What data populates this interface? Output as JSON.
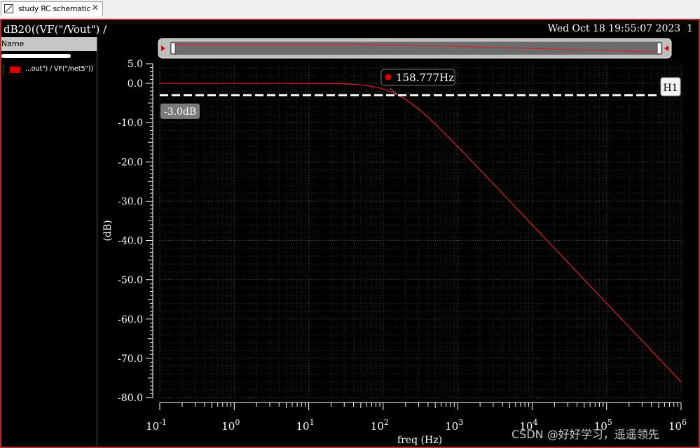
{
  "window": {
    "tab_label": "study RC schematic",
    "tab_close": "✕",
    "tab_icon": "schematic-icon"
  },
  "header": {
    "expression": "dB20((VF(\"/Vout\") /",
    "timestamp": "Wed Oct 18 19:55:07 2023",
    "subwindow_number": "1"
  },
  "sidebar": {
    "column_header": "Name",
    "traces": [
      {
        "label": "...out\") / VF(\"/net5\"))",
        "color": "#e00000"
      }
    ]
  },
  "chart_data": {
    "type": "line",
    "xscale": "log",
    "xlabel": "freq (Hz)",
    "ylabel": "(dB)",
    "xlim": [
      0.1,
      1000000
    ],
    "ylim": [
      -80,
      5
    ],
    "x_ticks": [
      {
        "base": "10",
        "exp": "-1",
        "value": 0.1
      },
      {
        "base": "10",
        "exp": "0",
        "value": 1
      },
      {
        "base": "10",
        "exp": "1",
        "value": 10
      },
      {
        "base": "10",
        "exp": "2",
        "value": 100
      },
      {
        "base": "10",
        "exp": "3",
        "value": 1000
      },
      {
        "base": "10",
        "exp": "4",
        "value": 10000
      },
      {
        "base": "10",
        "exp": "5",
        "value": 100000
      },
      {
        "base": "10",
        "exp": "6",
        "value": 1000000
      }
    ],
    "y_ticks": [
      {
        "label": "5.0",
        "value": 5
      },
      {
        "label": "0.0",
        "value": 0
      },
      {
        "label": "-10.0",
        "value": -10
      },
      {
        "label": "-20.0",
        "value": -20
      },
      {
        "label": "-30.0",
        "value": -30
      },
      {
        "label": "-40.0",
        "value": -40
      },
      {
        "label": "-50.0",
        "value": -50
      },
      {
        "label": "-60.0",
        "value": -60
      },
      {
        "label": "-70.0",
        "value": -70
      },
      {
        "label": "-80.0",
        "value": -80
      }
    ],
    "grid": true,
    "series": [
      {
        "color": "#e02020",
        "kind": "first-order low-pass",
        "cutoff_hz": 158.777,
        "points": [
          [
            0.1,
            0.0
          ],
          [
            1,
            0.0
          ],
          [
            10,
            -0.02
          ],
          [
            30,
            -0.15
          ],
          [
            100,
            -1.5
          ],
          [
            158.777,
            -3.0
          ],
          [
            300,
            -6.3
          ],
          [
            1000,
            -16.3
          ],
          [
            10000,
            -36.0
          ],
          [
            100000,
            -56.0
          ],
          [
            1000000,
            -76.0
          ]
        ]
      }
    ],
    "markers": [
      {
        "label": "158.777Hz",
        "x": 158.777,
        "y": -3.0,
        "color": "#e00000"
      }
    ],
    "horizontal_marker": {
      "label": "H1",
      "y": -3.0,
      "value_label": "-3.0dB"
    },
    "x_scrollbar": {
      "visible_fraction": 1.0
    }
  },
  "watermark": "CSDN @好好学习，遥遥领先"
}
